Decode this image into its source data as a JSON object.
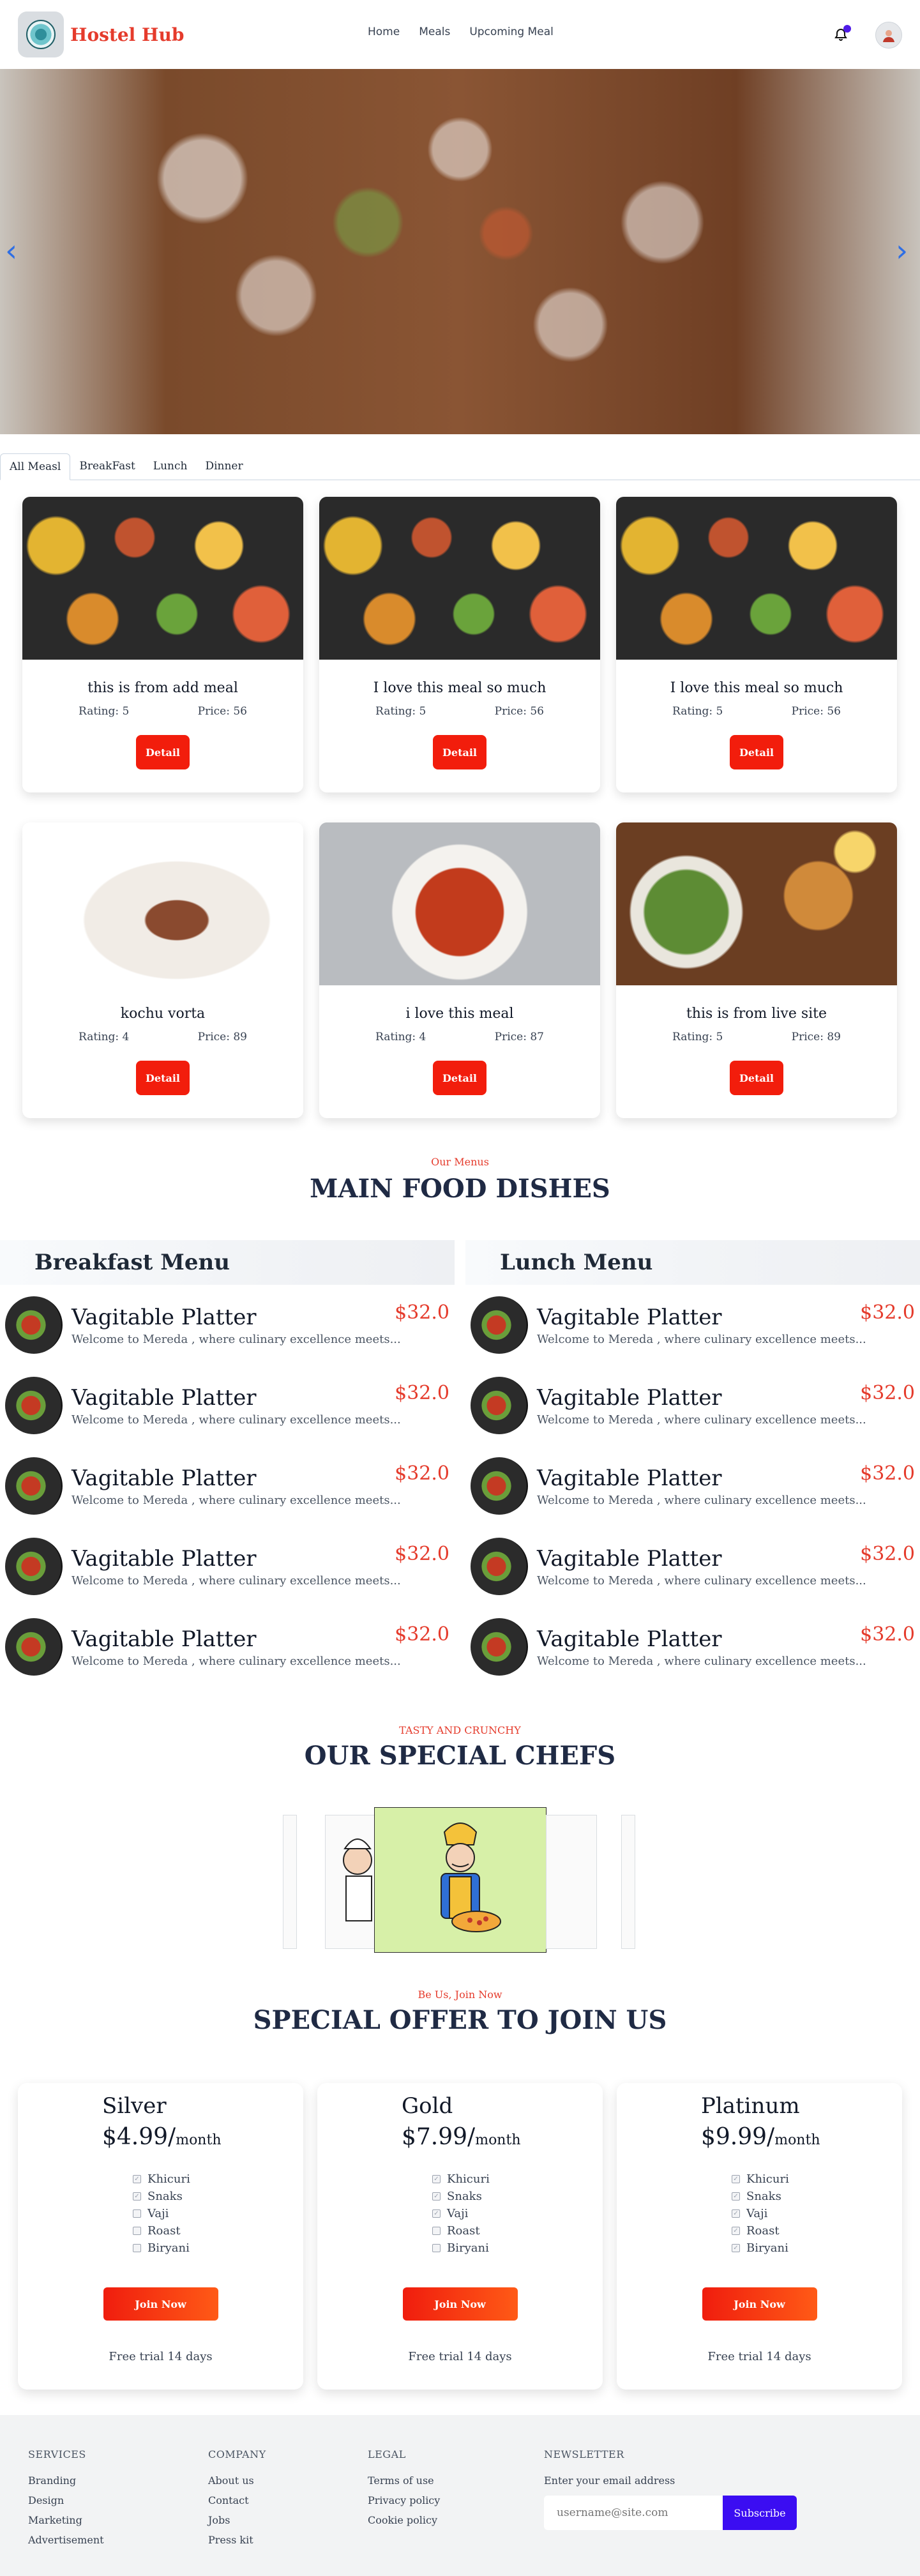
{
  "nav": {
    "brand": "Hostel Hub",
    "links": [
      "Home",
      "Meals",
      "Upcoming Meal"
    ],
    "icons": [
      "bell-icon",
      "avatar"
    ]
  },
  "tabs": [
    "All Measl",
    "BreakFast",
    "Lunch",
    "Dinner"
  ],
  "meals": [
    {
      "title": "this is from add meal",
      "rating": "Rating: 5",
      "price": "Price: 56",
      "button": "Detail"
    },
    {
      "title": "I love this meal so much",
      "rating": "Rating: 5",
      "price": "Price: 56",
      "button": "Detail"
    },
    {
      "title": "I love this meal so much",
      "rating": "Rating: 5",
      "price": "Price: 56",
      "button": "Detail"
    },
    {
      "title": "kochu vorta",
      "rating": "Rating: 4",
      "price": "Price: 89",
      "button": "Detail"
    },
    {
      "title": "i love this meal",
      "rating": "Rating: 4",
      "price": "Price: 87",
      "button": "Detail"
    },
    {
      "title": "this is from live site",
      "rating": "Rating: 5",
      "price": "Price: 89",
      "button": "Detail"
    }
  ],
  "menus_section": {
    "kicker": "Our Menus",
    "title": "MAIN FOOD DISHES"
  },
  "breakfast": {
    "title": "Breakfast Menu",
    "items": [
      {
        "name": "Vagitable Platter",
        "desc": "Welcome to Mereda , where culinary excellence meets...",
        "price": "$32.0"
      },
      {
        "name": "Vagitable Platter",
        "desc": "Welcome to Mereda , where culinary excellence meets...",
        "price": "$32.0"
      },
      {
        "name": "Vagitable Platter",
        "desc": "Welcome to Mereda , where culinary excellence meets...",
        "price": "$32.0"
      },
      {
        "name": "Vagitable Platter",
        "desc": "Welcome to Mereda , where culinary excellence meets...",
        "price": "$32.0"
      },
      {
        "name": "Vagitable Platter",
        "desc": "Welcome to Mereda , where culinary excellence meets...",
        "price": "$32.0"
      }
    ]
  },
  "lunch": {
    "title": "Lunch Menu",
    "items": [
      {
        "name": "Vagitable Platter",
        "desc": "Welcome to Mereda , where culinary excellence meets...",
        "price": "$32.0"
      },
      {
        "name": "Vagitable Platter",
        "desc": "Welcome to Mereda , where culinary excellence meets...",
        "price": "$32.0"
      },
      {
        "name": "Vagitable Platter",
        "desc": "Welcome to Mereda , where culinary excellence meets...",
        "price": "$32.0"
      },
      {
        "name": "Vagitable Platter",
        "desc": "Welcome to Mereda , where culinary excellence meets...",
        "price": "$32.0"
      },
      {
        "name": "Vagitable Platter",
        "desc": "Welcome to Mereda , where culinary excellence meets...",
        "price": "$32.0"
      }
    ]
  },
  "chefs_section": {
    "kicker": "TASTY AND CRUNCHY",
    "title": "OUR SPECIAL CHEFS"
  },
  "offer_section": {
    "kicker": "Be Us, Join Now",
    "title": "SPECIAL OFFER TO JOIN US"
  },
  "plans": [
    {
      "name": "Silver",
      "price": "$4.99/",
      "period": "month",
      "features": [
        "Khicuri",
        "Snaks",
        "Vaji",
        "Roast",
        "Biryani"
      ],
      "checked": [
        true,
        true,
        false,
        false,
        false
      ],
      "button": "Join Now",
      "trial": "Free trial 14 days"
    },
    {
      "name": "Gold",
      "price": "$7.99/",
      "period": "month",
      "features": [
        "Khicuri",
        "Snaks",
        "Vaji",
        "Roast",
        "Biryani"
      ],
      "checked": [
        true,
        true,
        true,
        false,
        false
      ],
      "button": "Join Now",
      "trial": "Free trial 14 days"
    },
    {
      "name": "Platinum",
      "price": "$9.99/",
      "period": "month",
      "features": [
        "Khicuri",
        "Snaks",
        "Vaji",
        "Roast",
        "Biryani"
      ],
      "checked": [
        true,
        true,
        true,
        true,
        true
      ],
      "button": "Join Now",
      "trial": "Free trial 14 days"
    }
  ],
  "footer": {
    "services": {
      "title": "SERVICES",
      "links": [
        "Branding",
        "Design",
        "Marketing",
        "Advertisement"
      ]
    },
    "company": {
      "title": "COMPANY",
      "links": [
        "About us",
        "Contact",
        "Jobs",
        "Press kit"
      ]
    },
    "legal": {
      "title": "LEGAL",
      "links": [
        "Terms of use",
        "Privacy policy",
        "Cookie policy"
      ]
    },
    "newsletter": {
      "title": "NEWSLETTER",
      "label": "Enter your email address",
      "placeholder": "username@site.com",
      "button": "Subscribe"
    }
  },
  "colors": {
    "accent": "#e53b2c",
    "button_red": "#f21d0c",
    "subscribe": "#3b0df2",
    "notification_dot": "#4f1ae8"
  }
}
